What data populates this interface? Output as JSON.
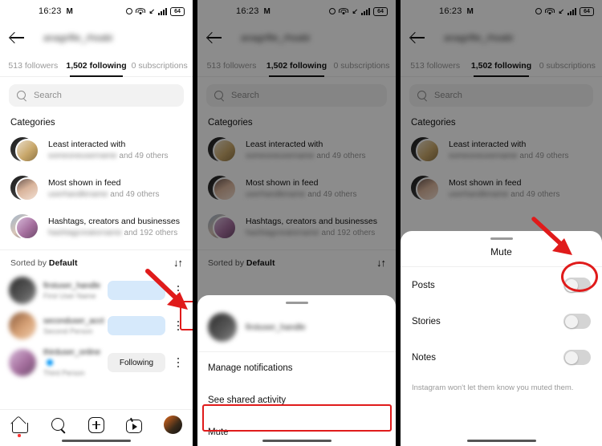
{
  "statusbar": {
    "time": "16:23",
    "carrier_glyph": "M",
    "icons": [
      "dnd-circle-icon",
      "wifi-icon",
      "volte-icon",
      "signal-bars-icon",
      "battery-icon"
    ],
    "battery_level": "64"
  },
  "header": {
    "back_icon": "back-arrow-icon",
    "username": "anagrifte_rhsabi"
  },
  "tabs": [
    {
      "label": "513 followers",
      "active": false
    },
    {
      "label": "1,502 following",
      "active": true
    },
    {
      "label": "0 subscriptions",
      "active": false
    }
  ],
  "search": {
    "placeholder": "Search",
    "value": "",
    "icon": "search-icon"
  },
  "categories": {
    "title": "Categories",
    "items": [
      {
        "title": "Least interacted with",
        "blurred_name": "someoneusername",
        "subtitle_suffix": "and 49 others"
      },
      {
        "title": "Most shown in feed",
        "blurred_name": "userhandlename",
        "subtitle_suffix": "and 49 others"
      },
      {
        "title": "Hashtags, creators and businesses",
        "blurred_name": "hashtagcreatorname",
        "subtitle_suffix": "and 192 others"
      }
    ]
  },
  "sorted_bar": {
    "prefix": "Sorted by ",
    "value": "Default",
    "sort_icon": "sort-arrows-icon"
  },
  "user_list": [
    {
      "name": "firstuser_handle",
      "fullname": "First User Name",
      "action": "",
      "action_style": "blue",
      "verified": false
    },
    {
      "name": "seconduser_acct",
      "fullname": "Second Person",
      "action": "",
      "action_style": "blue",
      "verified": false
    },
    {
      "name": "thirduser_online",
      "fullname": "Third Person",
      "action": "Following",
      "action_style": "gray",
      "verified": true
    }
  ],
  "bottom_nav": [
    {
      "icon": "home-icon",
      "badge": true
    },
    {
      "icon": "search-icon",
      "badge": false
    },
    {
      "icon": "create-plus-icon",
      "badge": false
    },
    {
      "icon": "reels-icon",
      "badge": false
    },
    {
      "icon": "profile-avatar",
      "badge": false
    }
  ],
  "options_sheet": {
    "grabber": "sheet-grabber",
    "username": "firstuser_handle",
    "items": [
      {
        "label": "Manage notifications",
        "highlighted": false
      },
      {
        "label": "See shared activity",
        "highlighted": false
      },
      {
        "label": "Mute",
        "highlighted": true
      }
    ]
  },
  "mute_sheet": {
    "title": "Mute",
    "rows": [
      {
        "label": "Posts",
        "on": false,
        "highlighted": true
      },
      {
        "label": "Stories",
        "on": false,
        "highlighted": false
      },
      {
        "label": "Notes",
        "on": false,
        "highlighted": false
      }
    ],
    "note": "Instagram won't let them know you muted them."
  },
  "annotations": {
    "color": "#e01b1b",
    "panel1_arrow": "arrow-pointing-to-kebab-menu",
    "panel1_box": "kebab-menu-highlight-box",
    "panel2_box": "mute-item-highlight-box",
    "panel3_arrow": "arrow-pointing-to-posts-toggle",
    "panel3_circle": "posts-toggle-highlight-circle"
  }
}
